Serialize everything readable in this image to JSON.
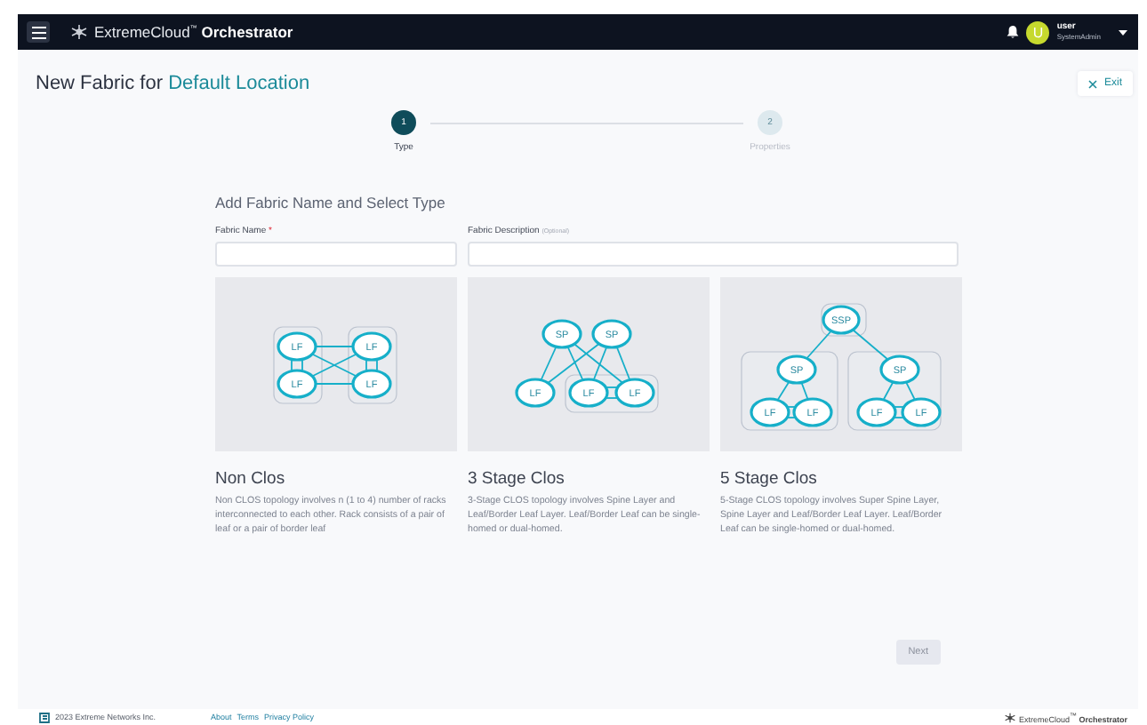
{
  "topbar": {
    "brand": "ExtremeCloud$^{™}$ **Orchestrator**",
    "user": {
      "initial": "U",
      "name": "user",
      "role": "SystemAdmin"
    }
  },
  "page": {
    "title": "New Fabric for",
    "location": "Default Location",
    "exit_button": "Exit"
  },
  "steps": [
    {
      "number": "1",
      "label": "Type",
      "selected": true
    },
    {
      "number": "2",
      "label": "Properties",
      "selected": false
    }
  ],
  "section_title": "Add Fabric Name and Select Type",
  "fields": [
    {
      "label": "Fabric Name",
      "required_mark": "*"
    },
    {
      "label": "Fabric Description",
      "hint": "(Optional)"
    }
  ],
  "fabric_types": [
    {
      "kind": "non-clos",
      "nodes": [
        "LF",
        "LF",
        "LF",
        "LF"
      ],
      "title": "Non Clos",
      "description": "Non CLOS topology involves n (1 to 4) number of racks interconnected to each other. Rack consists of a pair of leaf or a pair of border leaf"
    },
    {
      "kind": "three-stage",
      "nodes": [
        "SP",
        "SP",
        "LF",
        "LF",
        "LF"
      ],
      "title": "3 Stage Clos",
      "description": "3-Stage CLOS topology involves Spine Layer and Leaf/Border Leaf Layer. Leaf/Border Leaf can be single-homed or dual-homed."
    },
    {
      "kind": "five-stage",
      "nodes": [
        "SSP",
        "SP",
        "SP",
        "LF",
        "LF",
        "LF",
        "LF"
      ],
      "title": "5 Stage Clos",
      "description": "5-Stage CLOS topology involves Super Spine Layer, Spine Layer and Leaf/Border Leaf Layer. Leaf/Border Leaf can be single-homed or dual-homed."
    }
  ],
  "next_button": {
    "label": "Next",
    "disabled": true
  },
  "footer": {
    "copyright": "2023 Extreme Networks Inc.",
    "links": [
      "About",
      "Terms",
      "Privacy Policy"
    ],
    "brand": "ExtremeCloud$^{™}$ **Orchestrator**"
  }
}
